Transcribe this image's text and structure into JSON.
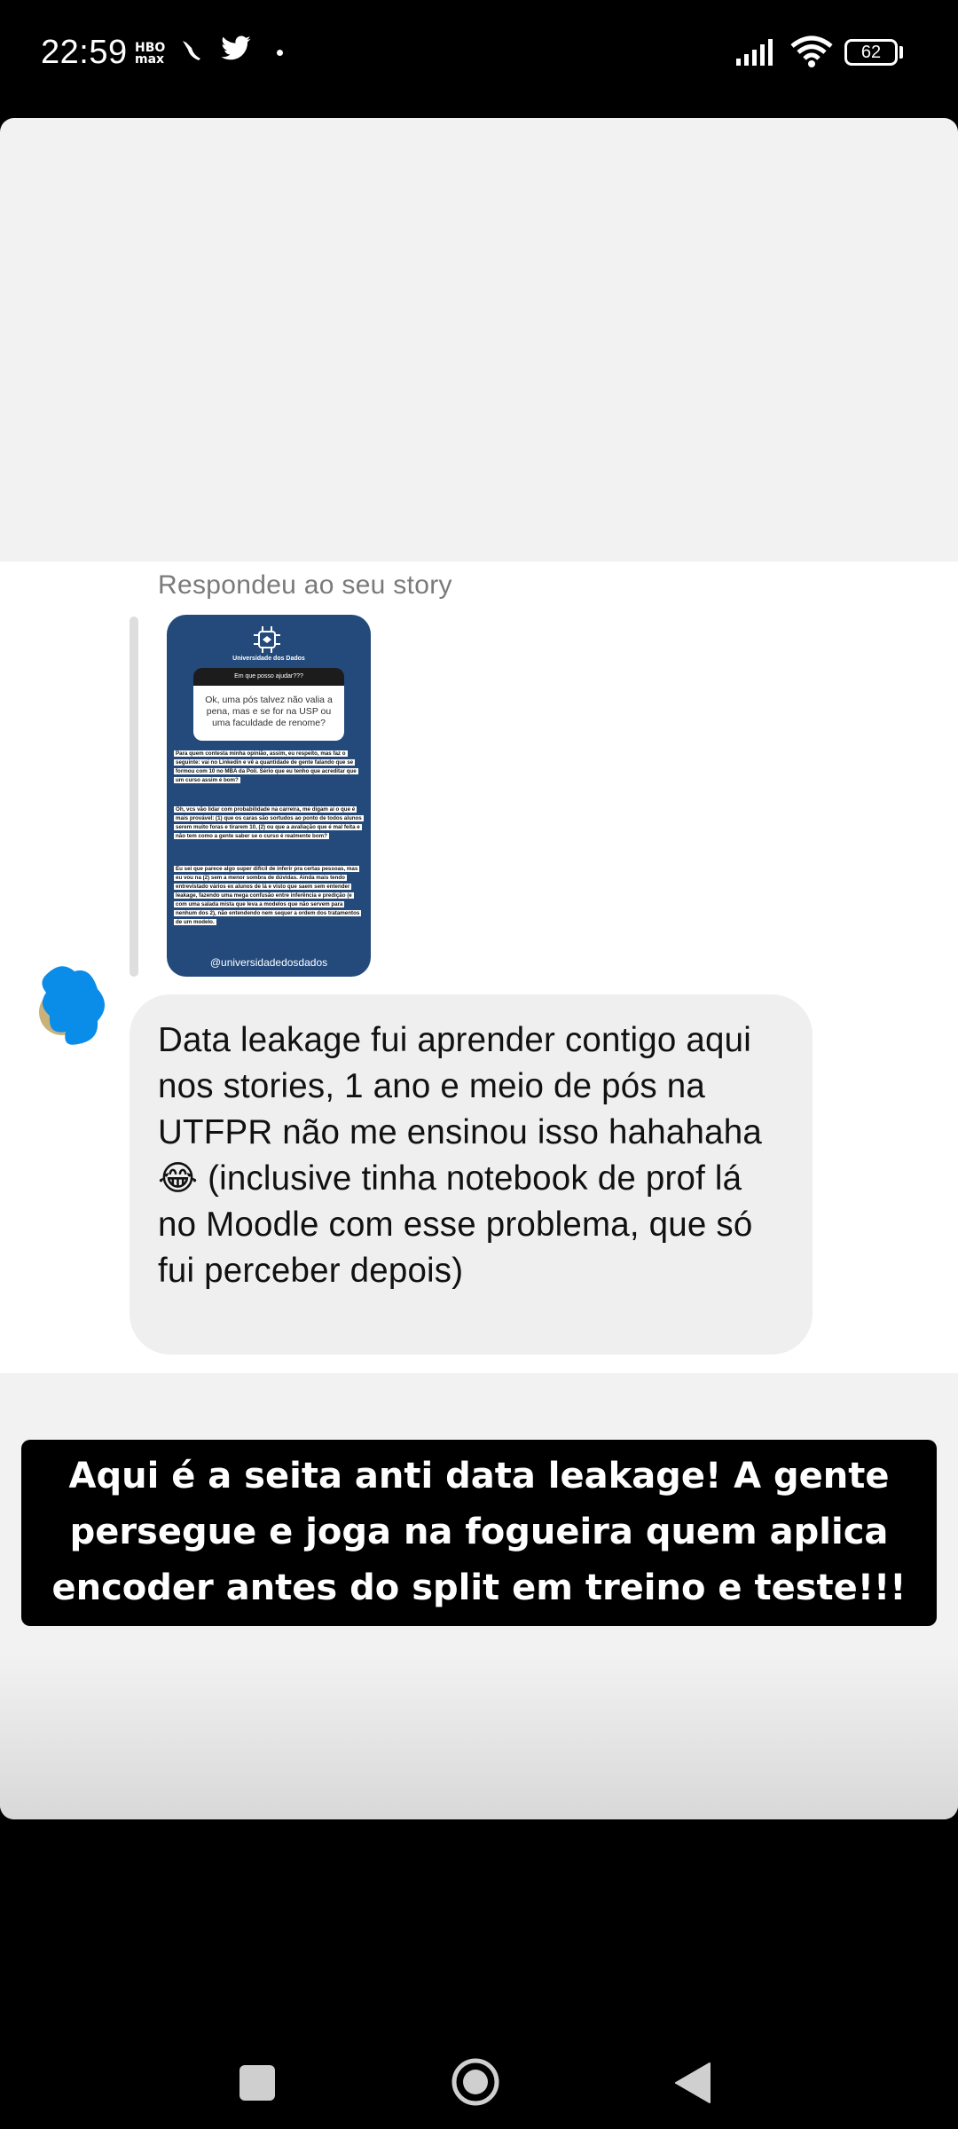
{
  "status_bar": {
    "time": "22:59",
    "hbo_badge_line1": "HBO",
    "hbo_badge_line2": "max",
    "battery_level": "62",
    "icons": [
      "hbo-max-icon",
      "bird-icon",
      "twitter-icon",
      "dot-icon",
      "signal-icon",
      "wifi-icon",
      "battery-icon"
    ]
  },
  "story": {
    "reply_label": "Respondeu ao seu story",
    "shared_story": {
      "brand": "Universidade dos Dados",
      "question_header": "Em que posso ajudar???",
      "question": "Ok, uma pós talvez não valia a pena, mas e se for na USP ou uma faculdade de renome?",
      "paragraph1": "Para quem contesta minha opinião, assim, eu respeito, mas faz o seguinte: vai no Linkedin e vê a quantidade de gente falando que se formou com 10 no MBA da Poli. Sério que eu tenho que acreditar que um curso assim é bom?",
      "paragraph2": "Oh, vcs vão lidar com probabilidade na carreira, me digam aí o que é mais provável: (1) que os caras são sortudos ao ponto de todos alunos serem muito foras e tirarem 10, (2) ou que a avaliação que é mal feita e não tem como a gente saber se o curso é realmente bom?",
      "paragraph3": "Eu sei que parece algo super difícil de inferir pra certas pessoas, mas eu vou na (2) sem a menor sombra de dúvidas. Ainda mais tendo entrevistado vários ex alunos de lá e visto que saem sem entender leakage, fazendo uma mega confusão entre inferência e predição (e com uma salada mista que leva a modelos que não servem para nenhum dos 2), não entendendo nem sequer a ordem dos tratamentos de um modelo.",
      "handle": "@universidadedosdados"
    },
    "message": "Data leakage fui aprender contigo aqui nos stories, 1 ano e meio de pós na UTFPR não me ensinou isso hahahaha 😂 (inclusive tinha notebook de prof lá no Moodle com esse problema, que só fui perceber depois)",
    "caption_line1": "Aqui é a seita anti data leakage! A gente",
    "caption_line2": "persegue e joga na fogueira quem aplica",
    "caption_line3": "encoder antes do split em treino e teste!!!"
  },
  "colors": {
    "story_background": "#234a7b",
    "bubble": "#efefef",
    "avatar_scribble": "#0a8de8",
    "caption_background": "#000000"
  },
  "nav_bar": {
    "buttons": [
      "recents-button",
      "home-button",
      "back-button"
    ]
  }
}
